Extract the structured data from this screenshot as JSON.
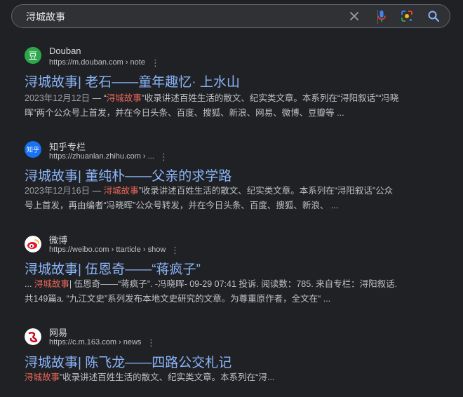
{
  "search": {
    "query": "浔城故事"
  },
  "icons": {
    "clear": "close-icon",
    "voice": "mic-icon",
    "lens": "lens-icon",
    "search": "search-icon"
  },
  "colors": {
    "link": "#8ab4f8",
    "highlight": "#ee675c",
    "background": "#202124"
  },
  "results": [
    {
      "site": "Douban",
      "url": "https://m.douban.com › note",
      "favicon_text": "豆",
      "title": "浔城故事| 老石——童年趣忆· 上水山",
      "date": "2023年12月12日",
      "sep": " — ",
      "snip_pre": "“",
      "snip_hl": "浔城故事",
      "snip_post": "”收录讲述百姓生活的散文、纪实类文章。本系列在“浔阳叙话”“冯晓",
      "snip_line2": "晖”两个公众号上首发，并在今日头条、百度、搜狐、新浪、网易、微博、豆瓣等 ..."
    },
    {
      "site": "知乎专栏",
      "url": "https://zhuanlan.zhihu.com › ...",
      "favicon_text": "知乎",
      "title": "浔城故事| 董纯朴——父亲的求学路",
      "date": "2023年12月16日",
      "sep": " — ",
      "snip_pre": "",
      "snip_hl": "浔城故事",
      "snip_post": "”收录讲述百姓生活的散文、纪实类文章。本系列在“浔阳叙话”公众",
      "snip_line2": "号上首发，再由编者“冯晓晖”公众号转发，并在今日头条、百度、搜狐、新浪、 ..."
    },
    {
      "site": "微博",
      "url": "https://weibo.com › ttarticle › show",
      "favicon_text": "",
      "title": "浔城故事| 伍恩奇——“蒋疯子”",
      "date": "",
      "sep": "",
      "snip_pre": "... ",
      "snip_hl": "浔城故事",
      "snip_post": "| 伍恩奇——“蒋疯子”. -冯晓晖- 09-29 07:41 投诉. 阅读数：785. 来自专栏：浔阳叙话.",
      "snip_line2": "共149篇a. “九江文史”系列发布本地文史研究的文章。为尊重原作者，全文在“ ..."
    },
    {
      "site": "网易",
      "url": "https://c.m.163.com › news",
      "favicon_text": "",
      "title": "浔城故事| 陈飞龙——四路公交札记",
      "date": "",
      "sep": "",
      "snip_pre": "",
      "snip_hl": "浔城故事",
      "snip_post": "”收录讲述百姓生活的散文、纪实类文章。本系列在“浔...",
      "snip_line2": ""
    }
  ]
}
